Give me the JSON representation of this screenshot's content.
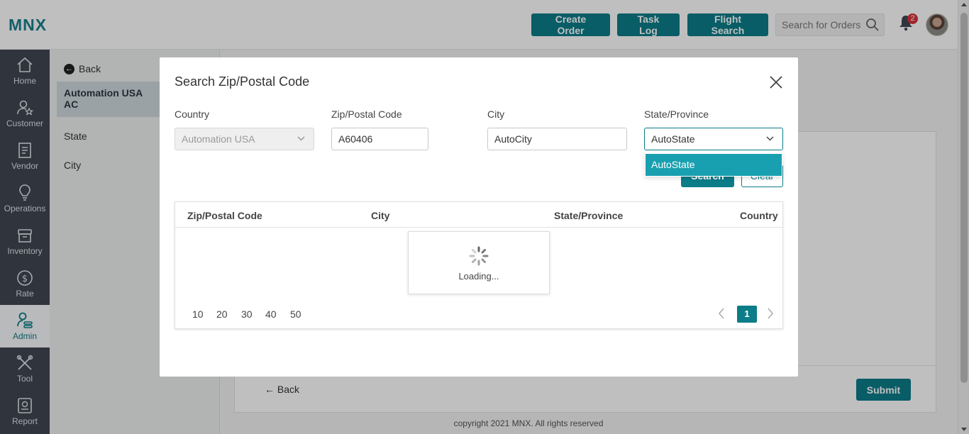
{
  "header": {
    "logo": "MNX",
    "buttons": {
      "create_order": "Create Order",
      "task_log": "Task Log",
      "flight_search": "Flight Search"
    },
    "search_placeholder": "Search for Orders",
    "notification_count": "2"
  },
  "sidebar": {
    "items": [
      {
        "label": "Home",
        "icon": "home-icon"
      },
      {
        "label": "Customer",
        "icon": "customer-icon"
      },
      {
        "label": "Vendor",
        "icon": "vendor-icon"
      },
      {
        "label": "Operations",
        "icon": "operations-icon"
      },
      {
        "label": "Inventory",
        "icon": "inventory-icon"
      },
      {
        "label": "Rate",
        "icon": "rate-icon"
      },
      {
        "label": "Admin",
        "icon": "admin-icon",
        "active": true
      },
      {
        "label": "Tool",
        "icon": "tool-icon"
      },
      {
        "label": "Report",
        "icon": "report-icon"
      }
    ]
  },
  "subpanel": {
    "back": "Back",
    "active_item": "Automation USA AC",
    "items": [
      "State",
      "City"
    ]
  },
  "main": {
    "back": "Back",
    "submit": "Submit",
    "copyright": "copyright 2021 MNX. All rights reserved"
  },
  "modal": {
    "title": "Search Zip/Postal Code",
    "fields": {
      "country": {
        "label": "Country",
        "value": "Automation USA"
      },
      "zip": {
        "label": "Zip/Postal Code",
        "value": "A60406"
      },
      "city": {
        "label": "City",
        "value": "AutoCity"
      },
      "state": {
        "label": "State/Province",
        "value": "AutoState"
      }
    },
    "dropdown_options": [
      "AutoState"
    ],
    "search_button": "Search",
    "clear_button": "Clear",
    "grid": {
      "columns": [
        "Zip/Postal Code",
        "City",
        "State/Province",
        "Country"
      ],
      "loading_text": "Loading...",
      "page_sizes": [
        "10",
        "20",
        "30",
        "40",
        "50"
      ],
      "current_page": "1"
    }
  },
  "colors": {
    "accent": "#0b7c88",
    "dropdown_highlight": "#19a0b0",
    "sidebar_bg": "#3f4652"
  }
}
